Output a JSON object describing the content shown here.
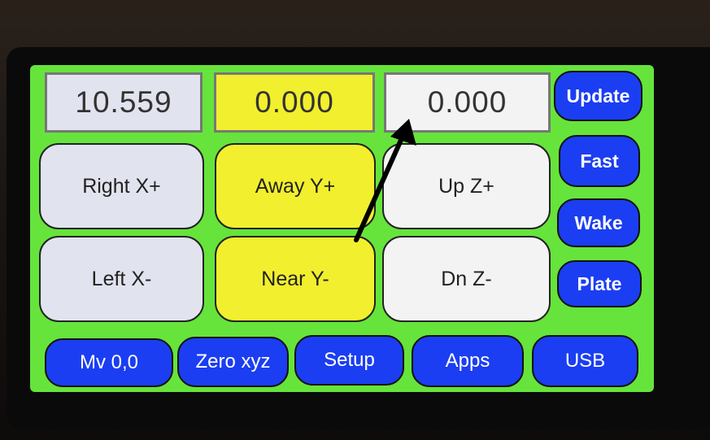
{
  "readouts": {
    "x": "10.559",
    "y": "0.000",
    "z": "0.000"
  },
  "jog": {
    "right_x_plus": "Right X+",
    "away_y_plus": "Away Y+",
    "up_z_plus": "Up Z+",
    "left_x_minus": "Left X-",
    "near_y_minus": "Near Y-",
    "dn_z_minus": "Dn Z-"
  },
  "side_buttons": {
    "update": "Update",
    "fast": "Fast",
    "wake": "Wake",
    "plate": "Plate"
  },
  "bottom_buttons": {
    "mv00": "Mv 0,0",
    "zero_xyz": "Zero xyz",
    "setup": "Setup",
    "apps": "Apps",
    "usb": "USB"
  },
  "colors": {
    "screen_background": "#66e43b",
    "button_blue": "#1b3ef2",
    "y_axis_yellow": "#f2ef2e",
    "x_axis_grey": "#e1e3ee",
    "z_axis_white": "#f3f3f3",
    "annotation_arrow": "#000000"
  }
}
